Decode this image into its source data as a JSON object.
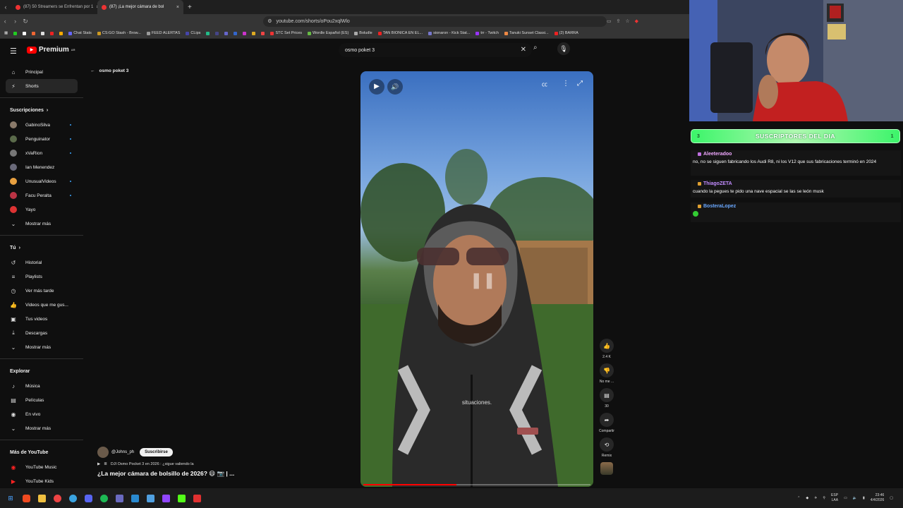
{
  "browser": {
    "tabs": [
      {
        "title": "(87) 50 Streamers se Enfrentan por 1",
        "active": false
      },
      {
        "title": "(87) ¡La mejor cámara de bol",
        "active": true
      }
    ],
    "url": "youtube.com/shorts/oPou2xqlWlo",
    "bookmarks": [
      "Chat Stats",
      "CS:GO Stash - Brow...",
      "FEED ALERTAS",
      "CLips",
      "STC Set Prices",
      "Wordle Español (ES)",
      "Boludle",
      "TAN BIONICA EN EL...",
      "sionaron - Kick Stat...",
      "trr - Twitch",
      "Tanuki Sunset Classi...",
      "(2) BARRA"
    ]
  },
  "youtube": {
    "logo_text": "Premium",
    "logo_region": "AR",
    "search_value": "osmo poket 3",
    "back_label": "osmo poket 3",
    "sidebar": {
      "main": [
        {
          "label": "Principal",
          "icon": "home-icon"
        },
        {
          "label": "Shorts",
          "icon": "shorts-icon"
        }
      ],
      "subscriptions_header": "Suscripciones",
      "subscriptions": [
        "GabinoSilva",
        "Penguinator",
        "xVaRion",
        "Ian Menendez",
        "UnusualVideos",
        "Facu Peralta",
        "Yayo"
      ],
      "subscriptions_more": "Mostrar más",
      "you_header": "Tú",
      "you": [
        "Historial",
        "Playlists",
        "Ver más tarde",
        "Videos que me gus...",
        "Tus videos",
        "Descargas"
      ],
      "you_more": "Mostrar más",
      "explore_header": "Explorar",
      "explore": [
        "Música",
        "Películas",
        "En vivo"
      ],
      "explore_more": "Mostrar más",
      "more_header": "Más de YouTube",
      "more": [
        "YouTube Music",
        "YouTube Kids"
      ]
    },
    "player": {
      "caption": "situaciones.",
      "progress": 0.41
    },
    "actions": {
      "like_count": "2.4 K",
      "dislike_label": "No me ...",
      "comment_count": "30",
      "share_label": "Compartir",
      "remix_label": "Remix"
    },
    "video": {
      "channel": "@Johns_ph",
      "subscribe_label": "Suscribirse",
      "description": "DJI Osmo Pocket 3 en 2026 : ¿sigue valiendo la",
      "title": "¿La mejor cámara de bolsillo de 2026? 😄 📷 | ..."
    }
  },
  "stream": {
    "subs_label": "SUSCRIPTORES DEL DIA",
    "subs_left": "3",
    "subs_right": "1",
    "messages": [
      {
        "user": "Aleeteradoo",
        "text": "no, no se siguen fabricando los Audi R8, ni los V12 que sus fabricaciones terminó en 2024",
        "color": "#f0a8ff"
      },
      {
        "user": "ThiagoZETA",
        "text": "cuando la pegues te pido una nave espacial se las se león musk",
        "color": "#c28cff"
      },
      {
        "user": "BosteraLopez",
        "text": "",
        "color": "#6aa8ff"
      }
    ]
  },
  "taskbar": {
    "lang_top": "ESP",
    "lang_bottom": "LAA",
    "time": "23:46",
    "date": "4/4/2026"
  }
}
